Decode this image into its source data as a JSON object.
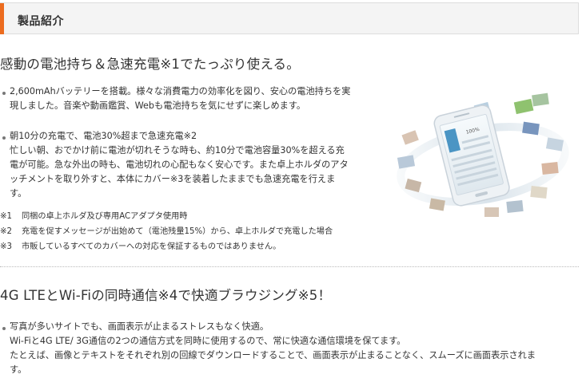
{
  "header": {
    "title": "製品紹介"
  },
  "section1": {
    "heading": "感動の電池持ち＆急速充電※1でたっぷり使える。",
    "bullet1_lines": [
      "2,600mAhバッテリーを搭載。様々な消費電力の効率化を図り、安心の電池持ちを実",
      "現しました。音楽や動画鑑賞、Webも電池持ちを気にせずに楽しめます。"
    ],
    "bullet2_lines": [
      "朝10分の充電で、電池30%超まで急速充電※2",
      "忙しい朝、おでかけ前に電池が切れそうな時も、約10分で電池容量30%を超える充",
      "電が可能。急な外出の時も、電池切れの心配もなく安心です。また卓上ホルダのアタ",
      "ッチメントを取り外すと、本体にカバー※3を装着したままでも急速充電を行えま",
      "す。"
    ],
    "notes": [
      {
        "mark": "※1",
        "text": "同梱の卓上ホルダ及び専用ACアダプタ使用時"
      },
      {
        "mark": "※2",
        "text": "充電を促すメッセージが出始めて（電池残量15%）から、卓上ホルダで充電した場合"
      },
      {
        "mark": "※3",
        "text": "市販しているすべてのカバーへの対応を保証するものではありません。"
      }
    ]
  },
  "section2": {
    "heading": "4G LTEとWi-Fiの同時通信※4で快適ブラウジング※5！",
    "bullet1_lines": [
      "写真が多いサイトでも、画面表示が止まるストレスもなく快適。",
      "Wi-Fiと4G LTE/ 3G通信の2つの通信方式を同時に使用するので、常に快適な通信環境を保てます。",
      "たとえば、画像とテキストをそれぞれ別の回線でダウンロードすることで、画面表示が止まることなく、スムーズに画面表示されま",
      "す。"
    ]
  },
  "image": {
    "accent": "#ec6c1f",
    "phone_color": "#e9eef2",
    "phone_screen_text": "100%"
  }
}
